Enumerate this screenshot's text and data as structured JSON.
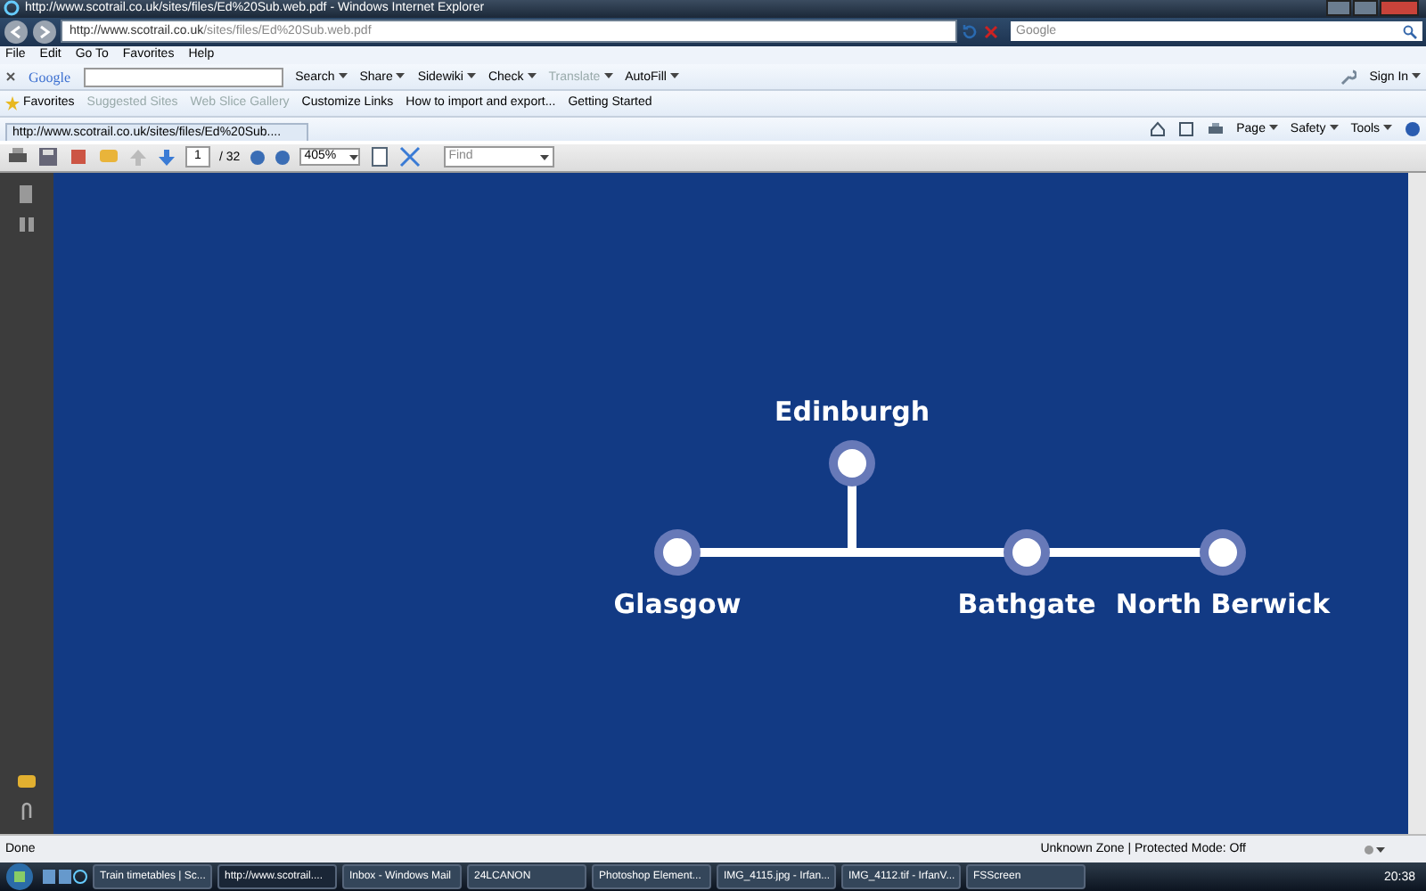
{
  "window": {
    "title": "http://www.scotrail.co.uk/sites/files/Ed%20Sub.web.pdf - Windows Internet Explorer"
  },
  "address_bar": {
    "url_host": "http://www.scotrail.co.uk",
    "url_path": "/sites/files/Ed%20Sub.web.pdf"
  },
  "search_box": {
    "placeholder": "Google"
  },
  "menu": [
    "File",
    "Edit",
    "Go To",
    "Favorites",
    "Help"
  ],
  "google_toolbar": {
    "logo": "Google",
    "items": [
      {
        "label": "Search",
        "disabled": false
      },
      {
        "label": "Share",
        "disabled": false
      },
      {
        "label": "Sidewiki",
        "disabled": false
      },
      {
        "label": "Check",
        "disabled": false
      },
      {
        "label": "Translate",
        "disabled": true
      },
      {
        "label": "AutoFill",
        "disabled": false
      }
    ],
    "sign_in": "Sign In"
  },
  "favorites_bar": {
    "favorites": "Favorites",
    "links": [
      {
        "label": "Suggested Sites",
        "disabled": true
      },
      {
        "label": "Web Slice Gallery",
        "disabled": true
      },
      {
        "label": "Customize Links",
        "disabled": false
      },
      {
        "label": "How to import and export...",
        "disabled": false
      },
      {
        "label": "Getting Started",
        "disabled": false
      }
    ]
  },
  "tab": {
    "label": "http://www.scotrail.co.uk/sites/files/Ed%20Sub...."
  },
  "command_bar": [
    "Page",
    "Safety",
    "Tools"
  ],
  "pdf_toolbar": {
    "page": "1",
    "page_count": "/ 32",
    "zoom": "405%",
    "find_placeholder": "Find"
  },
  "route_map": {
    "stations": [
      {
        "name": "Glasgow"
      },
      {
        "name": "Edinburgh"
      },
      {
        "name": "Bathgate"
      },
      {
        "name": "North Berwick"
      }
    ]
  },
  "status_bar": {
    "text": "Done",
    "zone": "Unknown Zone | Protected Mode: Off"
  },
  "taskbar": {
    "items": [
      {
        "label": "Train timetables | Sc...",
        "selected": false
      },
      {
        "label": "http://www.scotrail....",
        "selected": true
      },
      {
        "label": "Inbox - Windows Mail",
        "selected": false
      },
      {
        "label": "24LCANON",
        "selected": false
      },
      {
        "label": "Photoshop Element...",
        "selected": false
      },
      {
        "label": "IMG_4115.jpg - Irfan...",
        "selected": false
      },
      {
        "label": "IMG_4112.tif - IrfanV...",
        "selected": false
      },
      {
        "label": "FSScreen",
        "selected": false
      }
    ],
    "clock": "20:38"
  }
}
